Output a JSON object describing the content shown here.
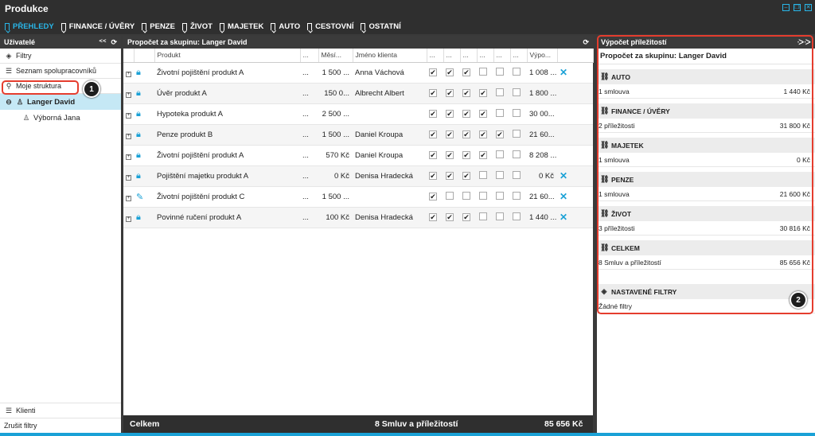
{
  "app": {
    "title": "Produkce"
  },
  "nav": [
    {
      "label": "PŘEHLEDY",
      "active": true
    },
    {
      "label": "FINANCE / ÚVĚRY",
      "active": false
    },
    {
      "label": "PENZE",
      "active": false
    },
    {
      "label": "ŽIVOT",
      "active": false
    },
    {
      "label": "MAJETEK",
      "active": false
    },
    {
      "label": "AUTO",
      "active": false
    },
    {
      "label": "CESTOVNÍ",
      "active": false
    },
    {
      "label": "OSTATNÍ",
      "active": false
    }
  ],
  "left": {
    "title": "Uživatelé",
    "items": [
      {
        "label": "Filtry",
        "icon": "layers-icon"
      },
      {
        "label": "Seznam spolupracovníků",
        "icon": "list-icon"
      },
      {
        "label": "Moje struktura",
        "icon": "org-structure-icon"
      }
    ],
    "tree": [
      {
        "label": "Langer David",
        "selected": true
      },
      {
        "label": "Výborná Jana",
        "selected": false
      }
    ],
    "bottom": {
      "clients_label": "Klienti",
      "clear_filters_label": "Zrušit filtry"
    }
  },
  "main": {
    "title": "Propočet za skupinu: Langer David",
    "columns": {
      "product": "Produkt",
      "dots": "...",
      "monthly": "Měsí...",
      "client": "Jméno klienta",
      "calc": "Výpo..."
    },
    "rows": [
      {
        "lock": true,
        "product": "Životní pojištění produkt A",
        "dots": "...",
        "amount": "1 500 ...",
        "client": "Anna Váchová",
        "checks": [
          true,
          true,
          true,
          false,
          false,
          false
        ],
        "calc": "1 008 ...",
        "remove": true
      },
      {
        "lock": true,
        "product": "Úvěr produkt A",
        "dots": "...",
        "amount": "150 0...",
        "client": "Albrecht Albert",
        "checks": [
          true,
          true,
          true,
          true,
          false,
          false
        ],
        "calc": "1 800 ...",
        "remove": false
      },
      {
        "lock": true,
        "product": "Hypoteka produkt A",
        "dots": "...",
        "amount": "2 500 ...",
        "client": "",
        "checks": [
          true,
          true,
          true,
          true,
          false,
          false
        ],
        "calc": "30 00...",
        "remove": false
      },
      {
        "lock": true,
        "product": "Penze produkt B",
        "dots": "...",
        "amount": "1 500 ...",
        "client": "Daniel Kroupa",
        "checks": [
          true,
          true,
          true,
          true,
          true,
          false
        ],
        "calc": "21 60...",
        "remove": false
      },
      {
        "lock": true,
        "product": "Životní pojištění produkt A",
        "dots": "...",
        "amount": "570 Kč",
        "client": "Daniel Kroupa",
        "checks": [
          true,
          true,
          true,
          true,
          false,
          false
        ],
        "calc": "8 208 ...",
        "remove": false
      },
      {
        "lock": true,
        "product": "Pojištění majetku produkt A",
        "dots": "...",
        "amount": "0 Kč",
        "client": "Denisa Hradecká",
        "checks": [
          true,
          true,
          true,
          false,
          false,
          false
        ],
        "calc": "0 Kč",
        "remove": true
      },
      {
        "lock": false,
        "product": "Životní pojištění produkt C",
        "dots": "...",
        "amount": "1 500 ...",
        "client": "",
        "checks": [
          true,
          false,
          false,
          false,
          false,
          false
        ],
        "calc": "21 60...",
        "remove": true
      },
      {
        "lock": true,
        "product": "Povinné ručení produkt A",
        "dots": "...",
        "amount": "100 Kč",
        "client": "Denisa Hradecká",
        "checks": [
          true,
          true,
          true,
          false,
          false,
          false
        ],
        "calc": "1 440 ...",
        "remove": true
      }
    ],
    "footer": {
      "label": "Celkem",
      "summary": "8 Smluv a příležitostí",
      "total": "85 656 Kč"
    }
  },
  "right": {
    "title": "Výpočet příležitostí",
    "subtitle": "Propočet za skupinu: Langer David",
    "sections": [
      {
        "name": "AUTO",
        "desc": "1 smlouva",
        "value": "1 440 Kč"
      },
      {
        "name": "FINANCE / ÚVĚRY",
        "desc": "2 příležitosti",
        "value": "31 800 Kč"
      },
      {
        "name": "MAJETEK",
        "desc": "1 smlouva",
        "value": "0 Kč"
      },
      {
        "name": "PENZE",
        "desc": "1 smlouva",
        "value": "21 600 Kč"
      },
      {
        "name": "ŽIVOT",
        "desc": "3 příležitosti",
        "value": "30 816 Kč"
      },
      {
        "name": "CELKEM",
        "desc": "8 Smluv a příležitostí",
        "value": "85 656 Kč"
      }
    ],
    "filters": {
      "title": "NASTAVENÉ FILTRY",
      "empty": "Žádné filtry"
    }
  },
  "annotations": [
    "1",
    "2"
  ],
  "colors": {
    "accent": "#1aa1d6",
    "dark": "#2f2f2f",
    "selected": "#c5e8f5",
    "highlight": "#e53d2e"
  }
}
